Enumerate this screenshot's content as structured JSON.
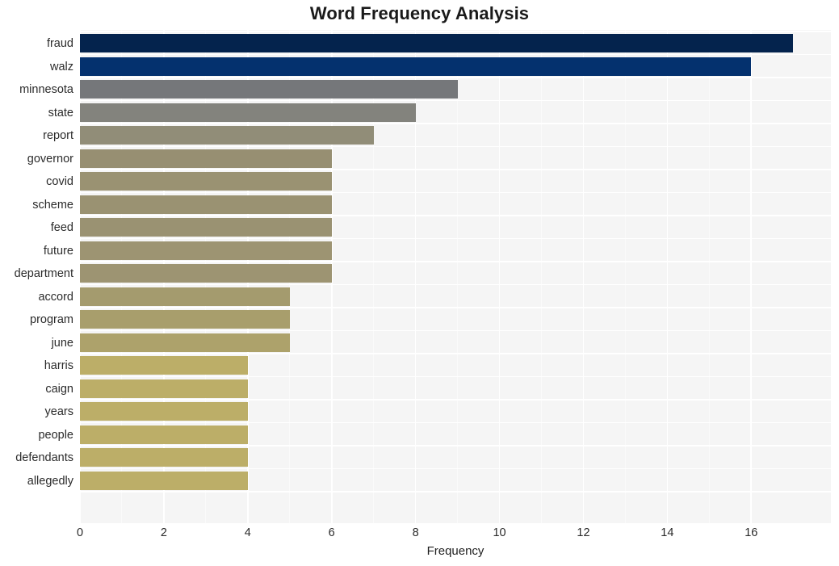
{
  "chart_data": {
    "type": "bar",
    "orientation": "horizontal",
    "title": "Word Frequency Analysis",
    "xlabel": "Frequency",
    "ylabel": "",
    "xlim": [
      0,
      17.9
    ],
    "grid": true,
    "legend": false,
    "xticks": [
      0,
      2,
      4,
      6,
      8,
      10,
      12,
      14,
      16
    ],
    "categories": [
      "fraud",
      "walz",
      "minnesota",
      "state",
      "report",
      "governor",
      "covid",
      "scheme",
      "feed",
      "future",
      "department",
      "accord",
      "program",
      "june",
      "harris",
      "caign",
      "years",
      "people",
      "defendants",
      "allegedly"
    ],
    "values": [
      17,
      16,
      9,
      8,
      7,
      6,
      6,
      6,
      6,
      6,
      6,
      5,
      5,
      5,
      4,
      4,
      4,
      4,
      4,
      4
    ],
    "bar_colors": [
      "#04234d",
      "#04316e",
      "#75777a",
      "#83837d",
      "#918d78",
      "#978f72",
      "#9a9272",
      "#9a9272",
      "#9a9272",
      "#9d9472",
      "#9d9472",
      "#a49b6e",
      "#a89e6c",
      "#ada26b",
      "#bcae68",
      "#bcae68",
      "#bcae68",
      "#bcae68",
      "#bcae68",
      "#bcae68"
    ],
    "panel_background": "#f5f5f5",
    "gridline_color": "#ffffff",
    "figure_background": "#ffffff",
    "text_color": "#2b2b2b"
  }
}
